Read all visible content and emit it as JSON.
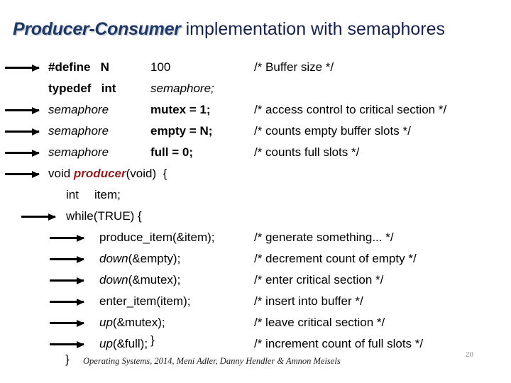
{
  "title": {
    "emphasis": "Producer-Consumer",
    "rest": " implementation with semaphores"
  },
  "colors": {
    "title_navy": "#1f3864",
    "function_red": "#8f1d1f",
    "page_number_gray": "#8c8c8c",
    "text_black": "#000000"
  },
  "code": {
    "lines": [
      {
        "arrow": "a",
        "col1": "#define   N",
        "col2": "100",
        "col3": "/* Buffer size */",
        "col1_style": "bold",
        "col2_style": "plain",
        "indent": "c1"
      },
      {
        "arrow": "",
        "col1": "typedef   int",
        "col2": "semaphore;",
        "col3": "",
        "col1_style": "bold",
        "col2_style": "italic",
        "indent": "c1"
      },
      {
        "arrow": "a",
        "col1": "semaphore",
        "col2": "mutex = 1;",
        "col3": "/* access control to critical section */",
        "col1_style": "italic",
        "col2_style": "bold",
        "indent": "c1"
      },
      {
        "arrow": "a",
        "col1": "semaphore",
        "col2": "empty = N;",
        "col3": "/* counts empty buffer slots */",
        "col1_style": "italic",
        "col2_style": "bold",
        "indent": "c1"
      },
      {
        "arrow": "a",
        "col1": "semaphore",
        "col2": "full = 0;",
        "col3": "/* counts full slots */",
        "col1_style": "italic",
        "col2_style": "bold",
        "indent": "c1"
      }
    ],
    "function_signature": {
      "arrow": "a",
      "prefix": "void ",
      "name": "producer",
      "suffix": "(void)  {"
    },
    "declaration": {
      "arrow": "",
      "keyword": "int",
      "variable": "item;"
    },
    "loop": {
      "arrow": "b",
      "text": "while(TRUE) {"
    },
    "body": [
      {
        "arrow": "c",
        "call": "produce_item(&item);",
        "emph": "",
        "args": "",
        "comment": "/* generate something... */"
      },
      {
        "arrow": "c",
        "call": "",
        "emph": "down",
        "args": "(&empty);",
        "comment": "/* decrement count of empty */"
      },
      {
        "arrow": "c",
        "call": "",
        "emph": "down",
        "args": "(&mutex);",
        "comment": "/* enter critical section */"
      },
      {
        "arrow": "c",
        "call": "enter_item(item);",
        "emph": "",
        "args": "",
        "comment": "/* insert into buffer */"
      },
      {
        "arrow": "c",
        "call": "",
        "emph": "up",
        "args": "(&mutex);",
        "comment": "/* leave critical section */"
      },
      {
        "arrow": "c",
        "call": "",
        "emph": "up",
        "args": "(&full);",
        "comment": "/* increment count of full slots */"
      }
    ],
    "brace_inner": "}",
    "brace_outer": "}"
  },
  "footer": {
    "credit": "Operating Systems, 2014, Meni Adler, Danny Hendler & Amnon Meisels",
    "page_number": "20"
  }
}
